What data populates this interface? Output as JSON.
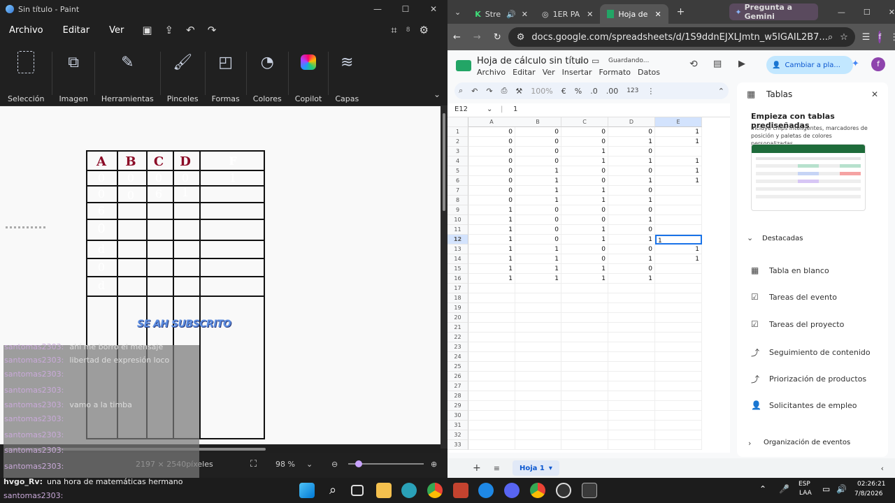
{
  "paint": {
    "title": "Sin título - Paint",
    "menu": [
      "Archivo",
      "Editar",
      "Ver"
    ],
    "badge_count": "8",
    "ribbon": [
      "Selección",
      "Imagen",
      "Herramientas",
      "Pinceles",
      "Formas",
      "Colores",
      "Copilot",
      "Capas"
    ],
    "status_dimensions": "2197 × 2540píxeles",
    "zoom": "98 %",
    "drawing": {
      "headers": [
        "A",
        "B",
        "C",
        "D",
        "F"
      ],
      "row1": [
        "0",
        "0",
        "0",
        "0",
        "1"
      ],
      "row2": [
        "0",
        "0",
        "6",
        "1"
      ],
      "col_a_rest": [
        "6",
        "0",
        "d",
        "0",
        "d"
      ],
      "overlay_text": "SE AH SUBSCRITO"
    }
  },
  "chat": [
    {
      "user": "santomas2303:",
      "message": "ahí me borro el mensaje"
    },
    {
      "user": "santomas2303:",
      "message": "libertad de expresión loco"
    },
    {
      "user": "santomas2303:",
      "message": ""
    },
    {
      "user": "santomas2303:",
      "message": ""
    },
    {
      "user": "santomas2303:",
      "message": "vamo a la timba"
    },
    {
      "user": "santomas2303:",
      "message": ""
    },
    {
      "user": "santomas2303:",
      "message": ""
    },
    {
      "user": "santomas2303:",
      "message": ""
    },
    {
      "user": "santomas2303:",
      "message": ""
    },
    {
      "user": "hvgo_Rv:",
      "message": "una hora de matemáticas hermano"
    },
    {
      "user": "santomas2303:",
      "message": ""
    }
  ],
  "chrome": {
    "tabs": [
      "Stre",
      "1ER PA",
      "Hoja de"
    ],
    "gemini": "Pregunta a Gemini",
    "url": "docs.google.com/spreadsheets/d/1S9ddnEJXLJmtn_w5IGAIL2B7...",
    "profile_initial": "f"
  },
  "sheets": {
    "title": "Hoja de cálculo sin título",
    "saving": "Guardando...",
    "menus": [
      "Archivo",
      "Editar",
      "Ver",
      "Insertar",
      "Formato",
      "Datos"
    ],
    "share_label": "Cambiar a pla...",
    "zoom": "100%",
    "format_items": [
      "€",
      "%",
      ".0",
      ".00",
      "123"
    ],
    "cell_ref": "E12",
    "formula": "1",
    "columns": [
      "A",
      "B",
      "C",
      "D",
      "E"
    ],
    "rows": [
      [
        "0",
        "0",
        "0",
        "0",
        "1"
      ],
      [
        "0",
        "0",
        "0",
        "1",
        "1"
      ],
      [
        "0",
        "0",
        "1",
        "0",
        ""
      ],
      [
        "0",
        "0",
        "1",
        "1",
        "1"
      ],
      [
        "0",
        "1",
        "0",
        "0",
        "1"
      ],
      [
        "0",
        "1",
        "0",
        "1",
        "1"
      ],
      [
        "0",
        "1",
        "1",
        "0",
        ""
      ],
      [
        "0",
        "1",
        "1",
        "1",
        ""
      ],
      [
        "1",
        "0",
        "0",
        "0",
        ""
      ],
      [
        "1",
        "0",
        "0",
        "1",
        ""
      ],
      [
        "1",
        "0",
        "1",
        "0",
        ""
      ],
      [
        "1",
        "0",
        "1",
        "1",
        "1"
      ],
      [
        "1",
        "1",
        "0",
        "0",
        "1"
      ],
      [
        "1",
        "1",
        "0",
        "1",
        "1"
      ],
      [
        "1",
        "1",
        "1",
        "0",
        ""
      ],
      [
        "1",
        "1",
        "1",
        "1",
        ""
      ]
    ],
    "total_row_labels": 33,
    "active_row": 12,
    "sheet_tab": "Hoja 1"
  },
  "tables_panel": {
    "title": "Tablas",
    "subtitle": "Empieza con tablas prediseñadas",
    "description": "Incluye chips inteligentes, marcadores de posición y paletas de colores personalizadas",
    "section": "Destacadas",
    "items": [
      "Tabla en blanco",
      "Tareas del evento",
      "Tareas del proyecto",
      "Seguimiento de contenido",
      "Priorización de productos",
      "Solicitantes de empleo"
    ],
    "footer_item": "Organización de eventos"
  },
  "taskbar": {
    "lang": "ESP",
    "lang_sub": "LAA",
    "time": "02:26:21",
    "date": "7/8/2026"
  }
}
